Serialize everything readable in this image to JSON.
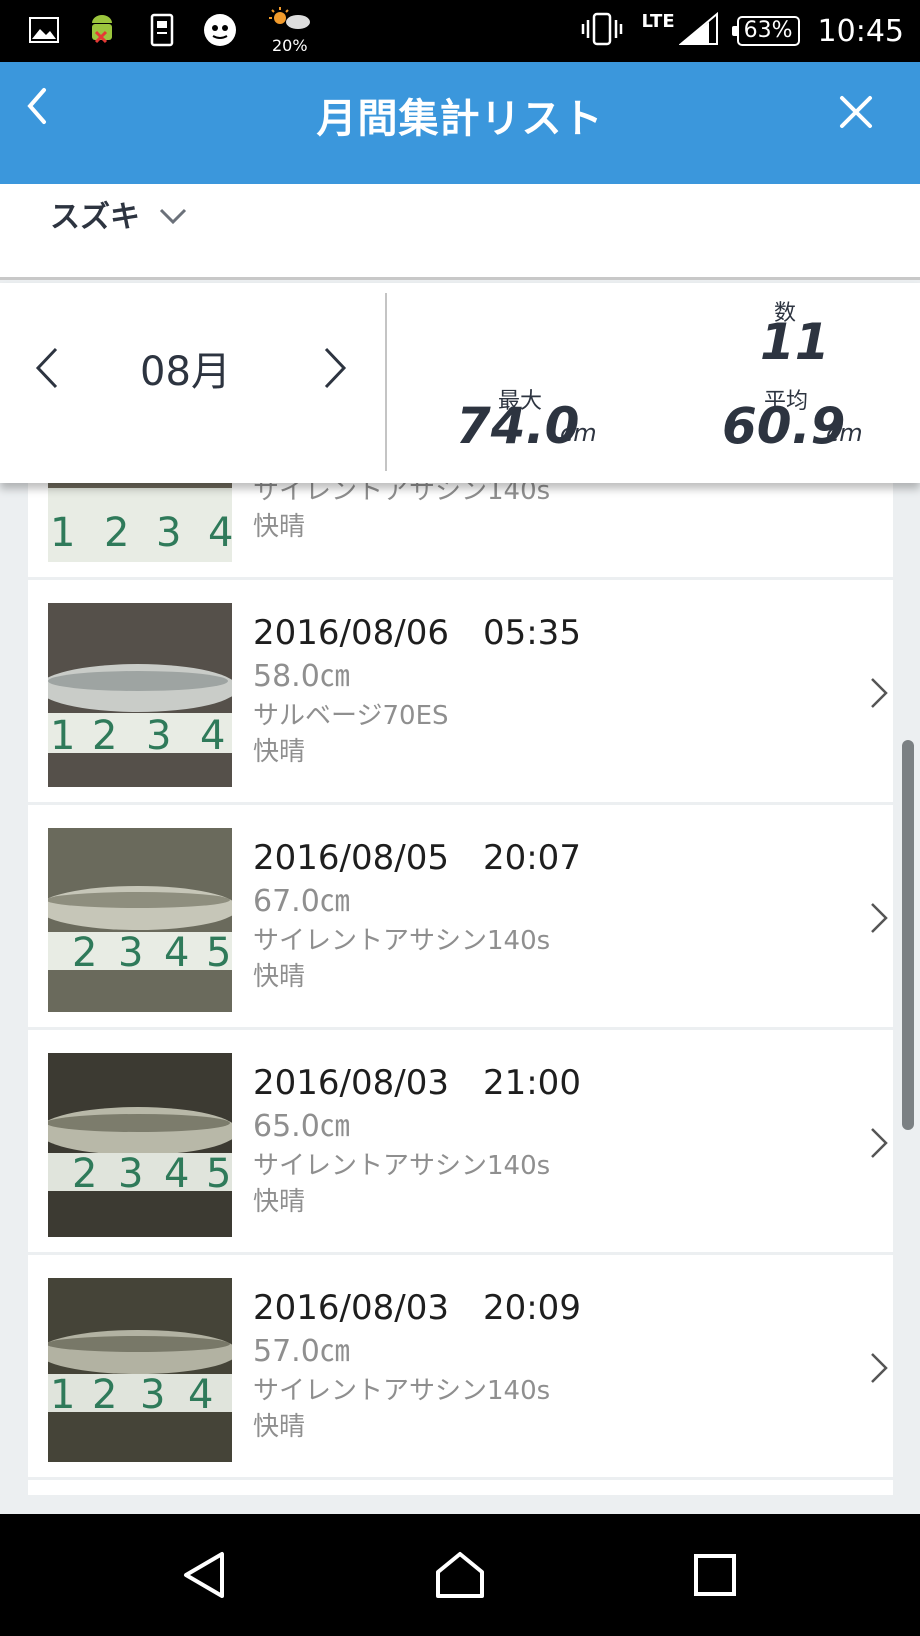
{
  "status_bar": {
    "weather_percent": "20%",
    "network": "LTE",
    "battery": "63%",
    "time": "10:45"
  },
  "header": {
    "title": "月間集計リスト"
  },
  "filter": {
    "species": "スズキ"
  },
  "summary": {
    "month": "08月",
    "count_label": "数",
    "count": "11",
    "max_label": "最大",
    "max_value": "74.0",
    "avg_label": "平均",
    "avg_value": "60.9",
    "unit": "cm"
  },
  "records": [
    {
      "datetime": "",
      "length": "",
      "lure": "サイレントアサシン140s",
      "weather": "快晴"
    },
    {
      "datetime": "2016/08/06　05:35",
      "length": "58.0㎝",
      "lure": "サルベージ70ES",
      "weather": "快晴"
    },
    {
      "datetime": "2016/08/05　20:07",
      "length": "67.0㎝",
      "lure": "サイレントアサシン140s",
      "weather": "快晴"
    },
    {
      "datetime": "2016/08/03　21:00",
      "length": "65.0㎝",
      "lure": "サイレントアサシン140s",
      "weather": "快晴"
    },
    {
      "datetime": "2016/08/03　20:09",
      "length": "57.0㎝",
      "lure": "サイレントアサシン140s",
      "weather": "快晴"
    }
  ],
  "colors": {
    "header_blue": "#3b97dc",
    "text_dark": "#2d3440",
    "text_gray": "#8f8f8f"
  }
}
